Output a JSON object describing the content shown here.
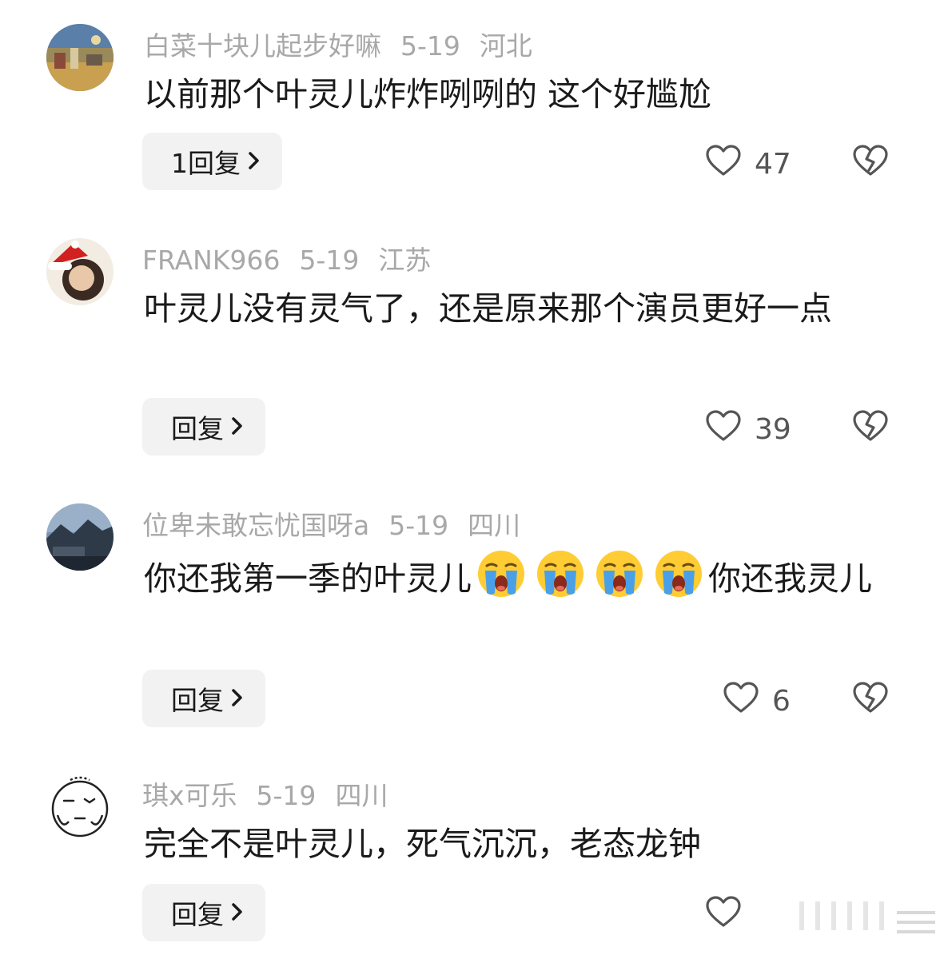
{
  "comments": [
    {
      "username": "白菜十块儿起步好嘛",
      "date": "5-19",
      "location": "河北",
      "text": "以前那个叶灵儿炸炸咧咧的 这个好尴尬",
      "reply_label": "1回复",
      "likes": "47",
      "avatar": "landscape-avatar"
    },
    {
      "username": "FRANK966",
      "date": "5-19",
      "location": "江苏",
      "text": "叶灵儿没有灵气了，还是原来那个演员更好一点",
      "reply_label": "回复",
      "likes": "39",
      "avatar": "santa-hat-avatar"
    },
    {
      "username": "位卑未敢忘忧国呀a",
      "date": "5-19",
      "location": "四川",
      "text_before": "你还我第一季的叶灵儿",
      "text_after": "你还我灵儿",
      "emoji": "crying-face-emoji",
      "emoji_count": 4,
      "reply_label": "回复",
      "likes": "6",
      "avatar": "mountain-avatar"
    },
    {
      "username": "琪x可乐",
      "date": "5-19",
      "location": "四川",
      "text": "完全不是叶灵儿，死气沉沉，老态龙钟",
      "reply_label": "回复",
      "likes": "",
      "avatar": "cartoon-face-avatar"
    }
  ],
  "icons": {
    "like": "heart-outline-icon",
    "dislike": "broken-heart-icon",
    "chevron": "chevron-right-icon"
  },
  "colors": {
    "meta_text": "#a8a8a8",
    "body_text": "#1a1a1a",
    "button_bg": "#f2f2f2",
    "icon_stroke": "#555555"
  }
}
